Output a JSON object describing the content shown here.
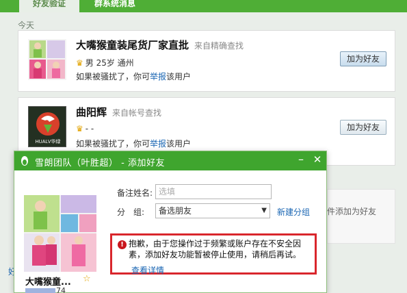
{
  "tabs": [
    {
      "label": "好友验证"
    },
    {
      "label": "群系统消息"
    }
  ],
  "section": {
    "today": "今天"
  },
  "requests": [
    {
      "name": "大嘴猴童装尾货厂家直批",
      "source": "来自精确查找",
      "meta": "男 25岁 通州",
      "warn_prefix": "如果被骚扰了，你可",
      "warn_link": "举报",
      "warn_suffix": "该用户",
      "add_button": "加为好友"
    },
    {
      "name": "曲阳辉",
      "source": "来自帐号查找",
      "meta": "- -",
      "warn_prefix": "如果被骚扰了，你可",
      "warn_link": "举报",
      "warn_suffix": "该用户",
      "add_button": "加为好友",
      "logo_text": "HUALV华绿"
    }
  ],
  "background": {
    "partial_text": "件添加为好友",
    "side_link": "好"
  },
  "dialog": {
    "title": "雪朗团队（叶胜超） - 添加好友",
    "minimize": "–",
    "close": "✕",
    "remark_label": "备注姓名:",
    "remark_placeholder": "选填",
    "group_label": "分　组:",
    "group_value": "备选朋友",
    "new_group": "新建分组",
    "contact_name": "大嘴猴童...",
    "contact_id_suffix": "74",
    "alert_text": "抱歉，由于您操作过于频繁或账户存在不安全因素，添加好友功能暂被停止使用，请稍后再试。",
    "alert_link": "查看详情"
  },
  "colors": {
    "header_green": "#4fae36",
    "dialog_title_green": "#3fa52e",
    "alert_border": "#d9262c",
    "link_blue": "#1a66b3"
  }
}
